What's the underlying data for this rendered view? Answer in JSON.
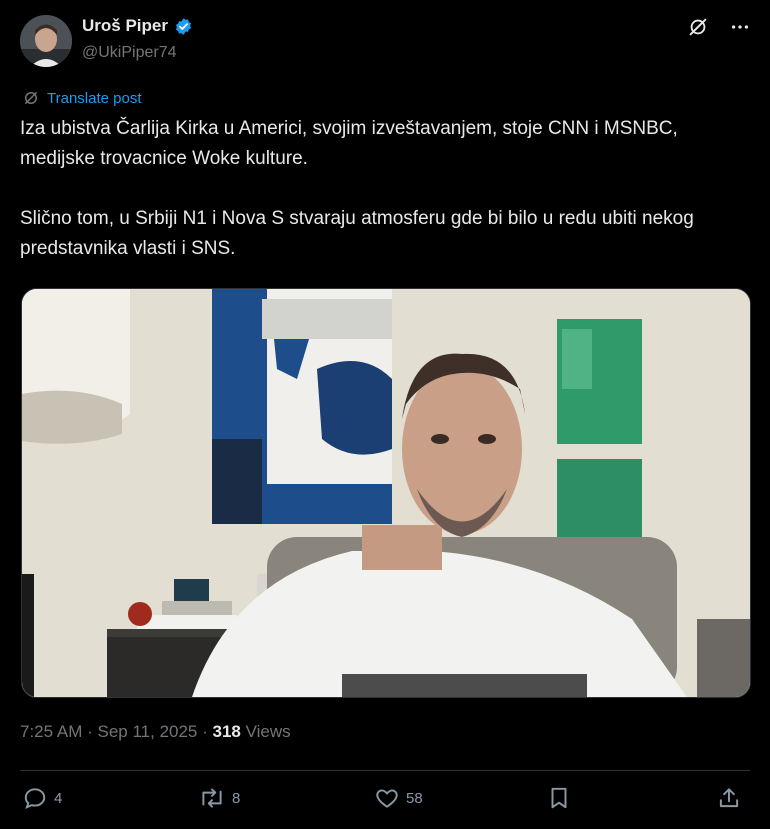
{
  "user": {
    "display_name": "Uroš Piper",
    "handle": "@UkiPiper74"
  },
  "translate_label": "Translate post",
  "text": "Iza ubistva Čarlija Kirka u Americi, svojim izveštavanjem, stoje CNN i MSNBC, medijske trovacnice Woke kulture.\n\nSlično tom, u Srbiji N1 i Nova S stvaraju atmosferu gde bi bilo u redu ubiti nekog predstavnika vlasti i SNS.",
  "meta": {
    "time": "7:25 AM",
    "date": "Sep 11, 2025",
    "views_count": "318",
    "views_label": "Views"
  },
  "actions": {
    "replies": "4",
    "reposts": "8",
    "likes": "58"
  },
  "colors": {
    "background": "#000000",
    "text": "#e7e9ea",
    "muted": "#71767b",
    "accent": "#1d9bf0"
  },
  "icons": [
    "verified-badge-icon",
    "grok-icon",
    "more-icon",
    "translate-icon",
    "reply-icon",
    "repost-icon",
    "like-icon",
    "bookmark-icon",
    "share-icon"
  ]
}
